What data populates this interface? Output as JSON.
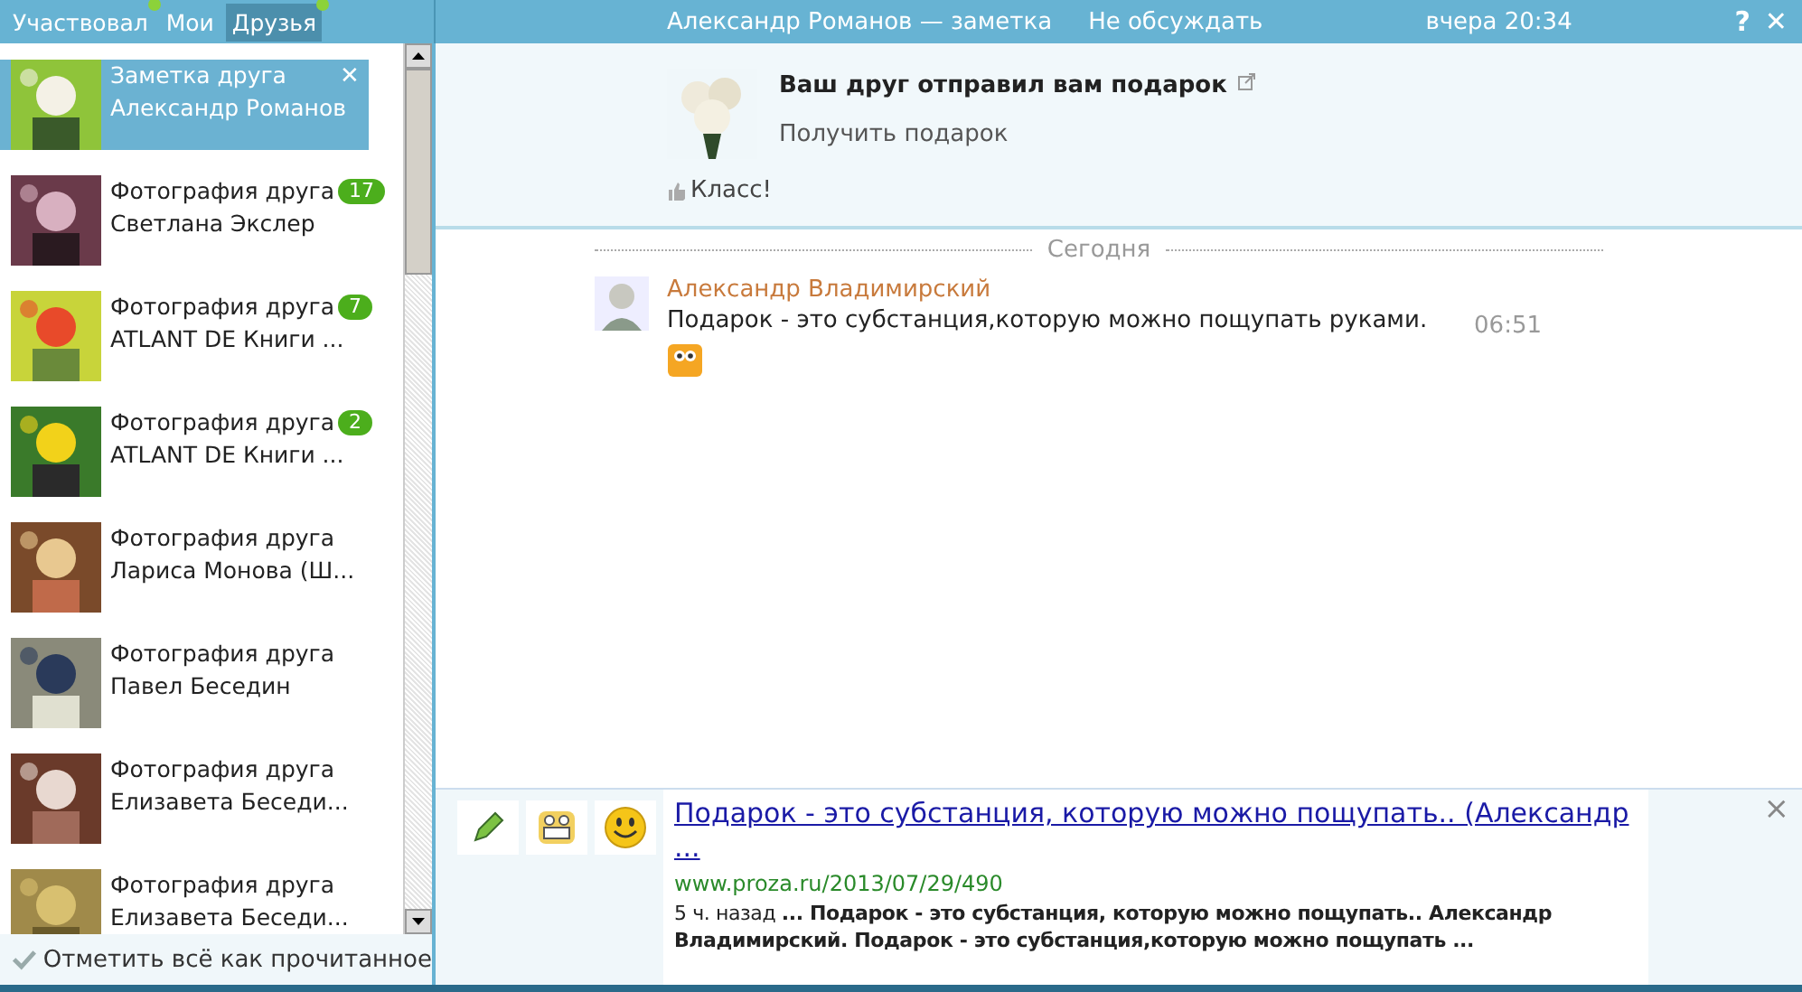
{
  "tabs": [
    {
      "label": "Участвовал",
      "selected": false,
      "new": true
    },
    {
      "label": "Мои",
      "selected": false,
      "new": false
    },
    {
      "label": "Друзья",
      "selected": true,
      "new": true
    }
  ],
  "header": {
    "title": "Александр Романов — заметка",
    "action": "Не обсуждать",
    "time": "вчера 20:34",
    "help": "?",
    "close": "✕"
  },
  "notifications": [
    {
      "type": "Заметка друга",
      "name": "Александр Романов",
      "selected": true
    },
    {
      "type": "Фотография друга",
      "name": "Светлана Экслер",
      "count": "17",
      "selected": false
    },
    {
      "type": "Фотография друга",
      "name": "ATLANT DE Книги ...",
      "count": "7",
      "selected": false
    },
    {
      "type": "Фотография друга",
      "name": "ATLANT DE Книги ...",
      "count": "2",
      "selected": false
    },
    {
      "type": "Фотография друга",
      "name": "Лариса Монова (Ш...",
      "selected": false
    },
    {
      "type": "Фотография друга",
      "name": "Павел Беседин",
      "selected": false
    },
    {
      "type": "Фотография друга",
      "name": "Елизавета Беседи...",
      "selected": false
    },
    {
      "type": "Фотография друга",
      "name": "Елизавета Беседи...",
      "selected": false
    }
  ],
  "mark_all_read": "Отметить всё как прочитанное",
  "gift": {
    "title": "Ваш друг отправил вам подарок",
    "action": "Получить подарок",
    "like": "Класс!"
  },
  "day_divider": "Сегодня",
  "messages": [
    {
      "author": "Александр Владимирский",
      "text": "Подарок - это субстанция,которую можно пощупать руками.",
      "time": "06:51"
    }
  ],
  "suggestion": {
    "title": "Подарок - это субстанция, которую можно пощупать.. (Александр ...",
    "url": "www.proza.ru/2013/07/29/490",
    "snippet": "5 ч. назад **... Подарок - это субстанция, которую можно пощупать.. Александр Владимирский. Подарок - это субстанция,которую можно пощупать ...**",
    "close": "×"
  }
}
